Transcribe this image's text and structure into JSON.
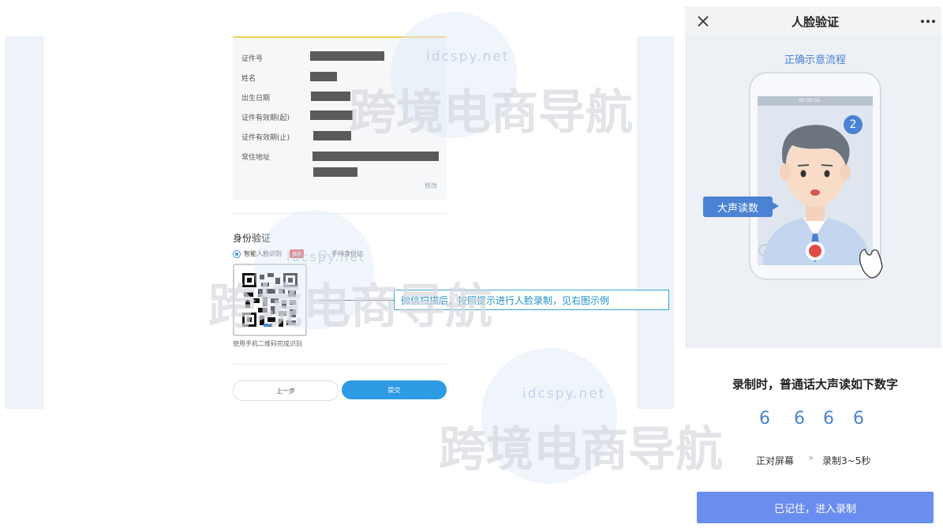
{
  "form": {
    "fields": [
      {
        "label": "证件号"
      },
      {
        "label": "姓名"
      },
      {
        "label": "出生日期"
      },
      {
        "label": "证件有效期(起)"
      },
      {
        "label": "证件有效期(止)"
      },
      {
        "label": "常住地址"
      }
    ],
    "edit_link": "修改"
  },
  "identity": {
    "section_title": "身份验证",
    "option_face": "智能人脸识别",
    "option_face_badge": "推荐",
    "option_hand": "手持身份证",
    "qr_hint": "使用手机二维码完成识别"
  },
  "buttons": {
    "prev": "上一步",
    "submit": "提交"
  },
  "annotation": "微信扫描后，按照提示进行人脸录制，见右图示例",
  "phone": {
    "title": "人脸验证",
    "demo_title": "正确示意流程",
    "speech_bubble": "大声读数",
    "step_number": "2",
    "recording_time": "00:00:02",
    "read_instruction": "录制时，普通话大声读如下数字",
    "digits": [
      "6",
      "6",
      "6",
      "6"
    ],
    "step_face": "正对屏幕",
    "step_sep": "»",
    "step_duration": "录制3~5秒",
    "confirm_button": "已记住，进入录制"
  },
  "watermark": {
    "text": "跨境电商导航",
    "domain": "idcspy.net"
  },
  "colors": {
    "accent_blue": "#2f9be4",
    "demo_blue": "#4b82d4",
    "record_button": "#6b8df0",
    "badge_red": "#e25555",
    "card_top_border": "#f3d15a"
  }
}
